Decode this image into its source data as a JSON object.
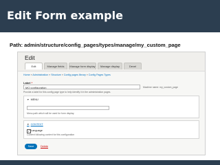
{
  "slide": {
    "title": "Edit Form example",
    "path_text": "Path: admin/structure/config_pages/types/manage/my_custom_page"
  },
  "admin_page": {
    "heading": "Edit",
    "tabs": [
      {
        "label": "Edit",
        "active": true
      },
      {
        "label": "Manage fields",
        "active": false
      },
      {
        "label": "Manage form display",
        "active": false
      },
      {
        "label": "Manage display",
        "active": false
      },
      {
        "label": "Devel",
        "active": false
      }
    ],
    "breadcrumb": [
      "Home",
      "Administration",
      "Structure",
      "Config pages library",
      "Config Pages Types"
    ],
    "label_field": {
      "label": "Label",
      "required_marker": "*",
      "value": "MO configuration",
      "machine_name": "Machine name: my_custom_page",
      "description": "Provide a label for this config page type to help identify it in the administration pages."
    },
    "menu_section": {
      "legend": "MENU",
      "description": "Menu path which will be used for form display."
    },
    "context_section": {
      "legend": "CONTEXT",
      "checkbox_label": "Language",
      "checkbox_checked": true,
      "checkbox_description": "Context following context for this configuration"
    },
    "actions": {
      "save_label": "Save",
      "delete_label": "Delete"
    }
  },
  "colors": {
    "header_bg": "#2c3e50",
    "link": "#0070c0",
    "save_button": "#0071b8",
    "delete_link": "#cc0000"
  }
}
